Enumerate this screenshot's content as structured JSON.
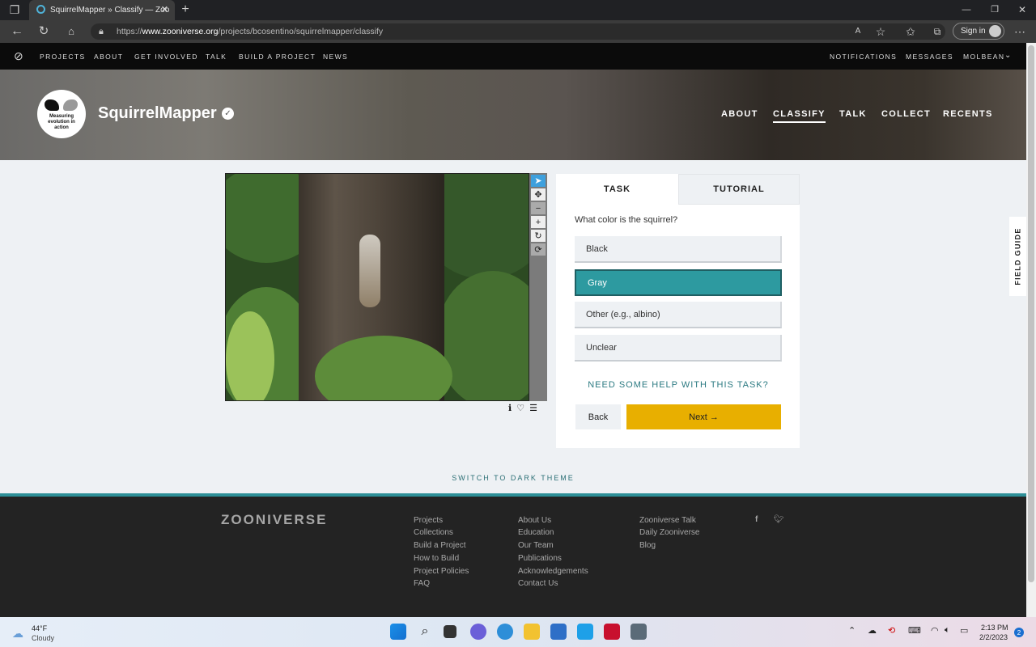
{
  "browser": {
    "tab_title": "SquirrelMapper » Classify — Zoo",
    "url_prefix": "https://",
    "url_host": "www.zooniverse.org",
    "url_path": "/projects/bcosentino/squirrelmapper/classify",
    "sign_in": "Sign in"
  },
  "site_nav": {
    "items": [
      "PROJECTS",
      "ABOUT",
      "GET INVOLVED",
      "TALK",
      "BUILD A PROJECT",
      "NEWS"
    ],
    "right": [
      "NOTIFICATIONS",
      "MESSAGES",
      "MOLBEAN"
    ]
  },
  "project": {
    "logo_text": "Measuring evolution in action",
    "title": "SquirrelMapper",
    "nav": [
      "ABOUT",
      "CLASSIFY",
      "TALK",
      "COLLECT",
      "RECENTS"
    ]
  },
  "task": {
    "tabs": [
      "TASK",
      "TUTORIAL"
    ],
    "question": "What color is the squirrel?",
    "answers": [
      "Black",
      "Gray",
      "Other (e.g., albino)",
      "Unclear"
    ],
    "selected_answer": "Gray",
    "help": "NEED SOME HELP WITH THIS TASK?",
    "back": "Back",
    "next": "Next →"
  },
  "field_guide": "FIELD GUIDE",
  "dark_theme": "SWITCH TO DARK THEME",
  "footer": {
    "logo": "ZOONIVERSE",
    "col1": [
      "Projects",
      "Collections",
      "Build a Project",
      "How to Build",
      "Project Policies",
      "FAQ"
    ],
    "col2": [
      "About Us",
      "Education",
      "Our Team",
      "Publications",
      "Acknowledgements",
      "Contact Us"
    ],
    "col3": [
      "Zooniverse Talk",
      "Daily Zooniverse",
      "Blog"
    ]
  },
  "taskbar": {
    "temp": "44°F",
    "weather": "Cloudy",
    "time": "2:13 PM",
    "date": "2/2/2023",
    "notifications": "2"
  },
  "colors": {
    "accent_teal": "#2d9aa0",
    "next_yellow": "#e8af00"
  }
}
